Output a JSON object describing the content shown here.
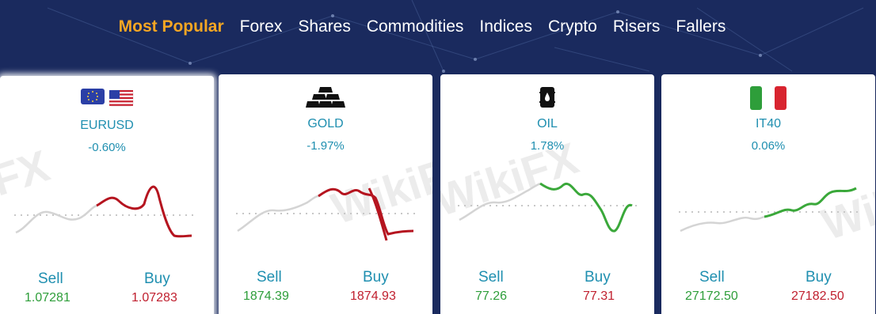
{
  "tabs": [
    {
      "label": "Most Popular",
      "active": true
    },
    {
      "label": "Forex",
      "active": false
    },
    {
      "label": "Shares",
      "active": false
    },
    {
      "label": "Commodities",
      "active": false
    },
    {
      "label": "Indices",
      "active": false
    },
    {
      "label": "Crypto",
      "active": false
    },
    {
      "label": "Risers",
      "active": false
    },
    {
      "label": "Fallers",
      "active": false
    }
  ],
  "cards": [
    {
      "name": "EURUSD",
      "change": "-0.60%",
      "sell_label": "Sell",
      "buy_label": "Buy",
      "sell": "1.07281",
      "buy": "1.07283",
      "icon": "eu-us-flags-icon",
      "trend": "down"
    },
    {
      "name": "GOLD",
      "change": "-1.97%",
      "sell_label": "Sell",
      "buy_label": "Buy",
      "sell": "1874.39",
      "buy": "1874.93",
      "icon": "gold-bars-icon",
      "trend": "down"
    },
    {
      "name": "OIL",
      "change": "1.78%",
      "sell_label": "Sell",
      "buy_label": "Buy",
      "sell": "77.26",
      "buy": "77.31",
      "icon": "oil-barrel-icon",
      "trend": "up"
    },
    {
      "name": "IT40",
      "change": "0.06%",
      "sell_label": "Sell",
      "buy_label": "Buy",
      "sell": "27172.50",
      "buy": "27182.50",
      "icon": "italy-flag-icon",
      "trend": "up"
    }
  ],
  "watermark": "WikiFX",
  "colors": {
    "background": "#1a2a5e",
    "active_tab": "#f5a623",
    "label": "#1f8fb0",
    "sell": "#2e9e3a",
    "buy": "#c0202f",
    "down_line": "#b5141f",
    "up_line": "#3aa83a"
  }
}
